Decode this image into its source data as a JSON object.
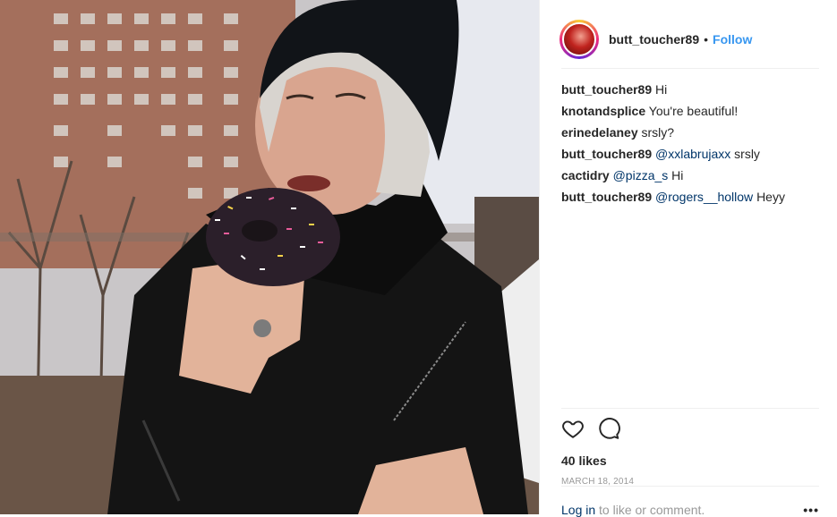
{
  "post": {
    "photo_alt": "Photo"
  },
  "header": {
    "username": "butt_toucher89",
    "separator": "•",
    "follow_label": "Follow"
  },
  "comments": [
    {
      "user": "butt_toucher89",
      "mention": "",
      "text": "Hi"
    },
    {
      "user": "knotandsplice",
      "mention": "",
      "text": "You're beautiful!"
    },
    {
      "user": "erinedelaney",
      "mention": "",
      "text": "srsly?"
    },
    {
      "user": "butt_toucher89",
      "mention": "@xxlabrujaxx",
      "text": "srsly"
    },
    {
      "user": "cactidry",
      "mention": "@pizza_s",
      "text": "Hi"
    },
    {
      "user": "butt_toucher89",
      "mention": "@rogers__hollow",
      "text": "Heyy"
    }
  ],
  "actions": {
    "like_icon": "heart-icon",
    "comment_icon": "comment-icon"
  },
  "likes_text": "40 likes",
  "date_text": "MARCH 18, 2014",
  "footer": {
    "login_label": "Log in",
    "login_suffix": "to like or comment.",
    "more_label": "•••"
  },
  "colors": {
    "link_blue": "#3897f0",
    "mention_blue": "#003569",
    "muted": "#999999"
  }
}
